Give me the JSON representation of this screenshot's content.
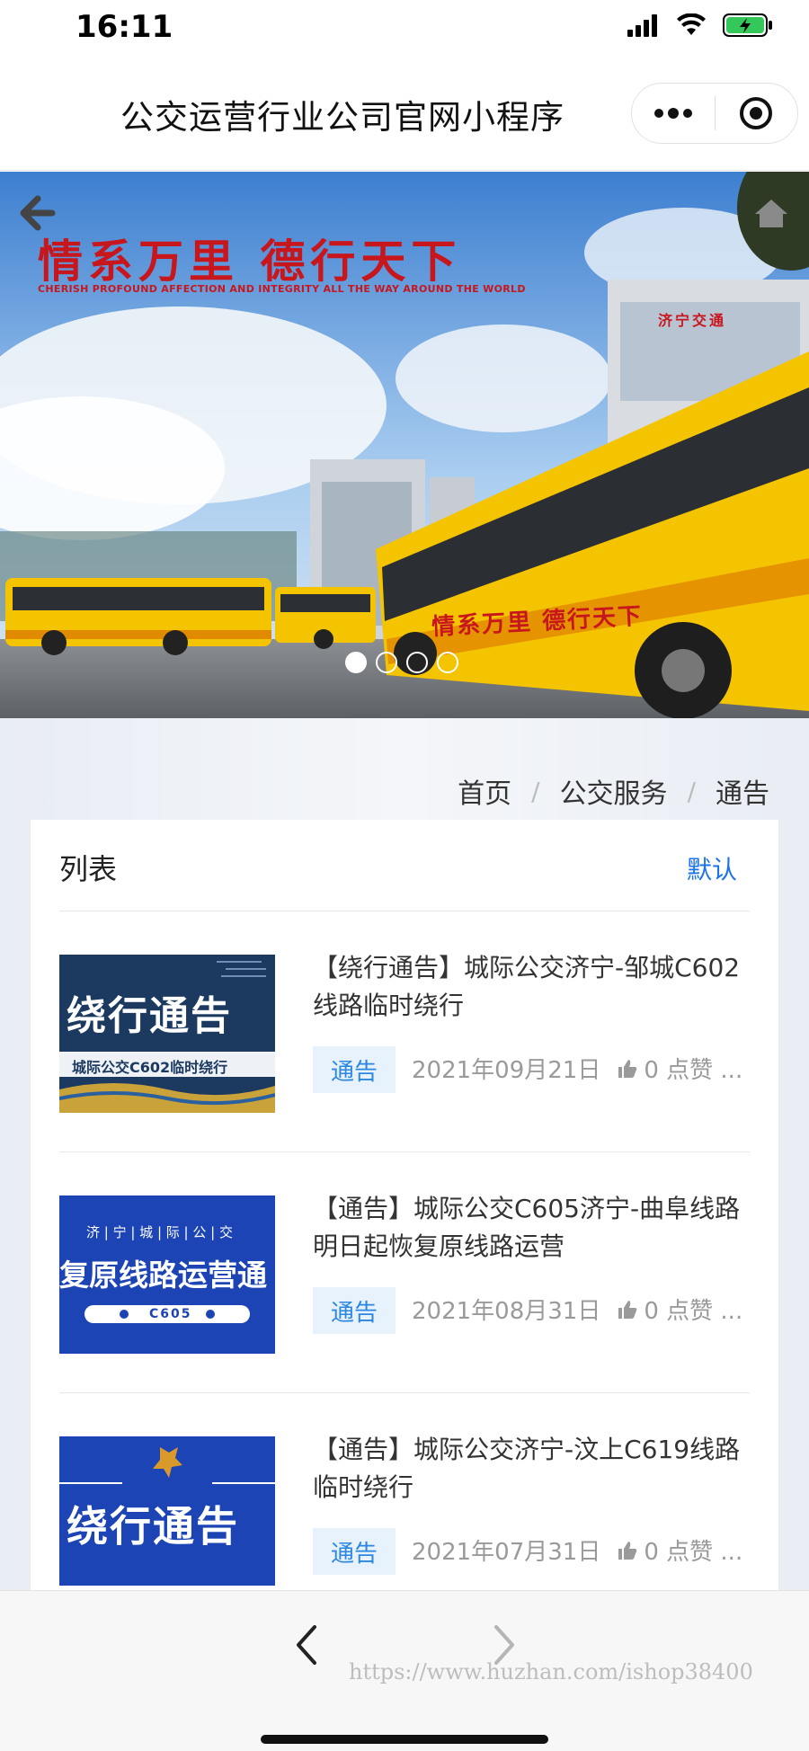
{
  "status_bar": {
    "time": "16:11"
  },
  "nav": {
    "title": "公交运营行业公司官网小程序"
  },
  "banner": {
    "slogan": "情系万里 德行天下",
    "slogan_en": "CHERISH PROFOUND AFFECTION AND INTEGRITY ALL THE WAY AROUND THE WORLD",
    "building_sign": "济宁交通",
    "bus_livery": "情系万里 德行天下",
    "slides": 4,
    "active_slide": 1
  },
  "breadcrumb": {
    "home": "首页",
    "section": "公交服务",
    "current": "通告",
    "separator": "/"
  },
  "list": {
    "title": "列表",
    "sort_label": "默认",
    "items": [
      {
        "title": "【绕行通告】城际公交济宁-邹城C602线路临时绕行",
        "tag": "通告",
        "date": "2021年09月21日",
        "likes": "0 点赞 ...",
        "thumb": {
          "headline": "绕行通告",
          "subline": "城际公交C602临时绕行"
        }
      },
      {
        "title": "【通告】城际公交C605济宁-曲阜线路明日起恢复原线路运营",
        "tag": "通告",
        "date": "2021年08月31日",
        "likes": "0 点赞 ...",
        "thumb": {
          "topline": "济 | 宁 | 城 | 际 | 公 | 交",
          "headline": "复原线路运营通",
          "pill": "C605"
        }
      },
      {
        "title": "【通告】城际公交济宁-汶上C619线路临时绕行",
        "tag": "通告",
        "date": "2021年07月31日",
        "likes": "0 点赞 ...",
        "thumb": {
          "headline": "绕行通告"
        }
      }
    ]
  },
  "footer": {
    "watermark": "https://www.huzhan.com/ishop38400"
  },
  "colors": {
    "accent": "#1a73e8",
    "tag_bg": "#e7f2fd",
    "tag_text": "#2b87e0",
    "slogan_red": "#c8161d",
    "bus_yellow": "#f5c400"
  }
}
